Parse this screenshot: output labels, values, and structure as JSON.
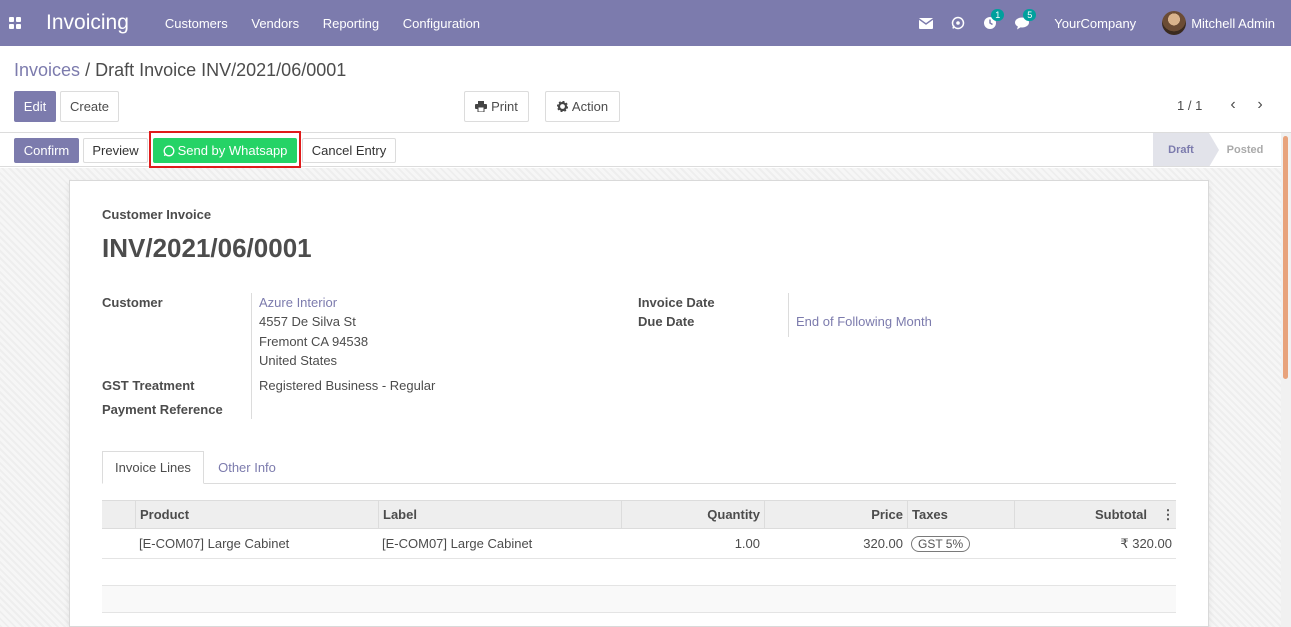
{
  "navbar": {
    "app_title": "Invoicing",
    "menu": [
      "Customers",
      "Vendors",
      "Reporting",
      "Configuration"
    ],
    "activity_count": "1",
    "messages_count": "5",
    "company": "YourCompany",
    "user": "Mitchell Admin"
  },
  "breadcrumb": {
    "parent": "Invoices",
    "separator": "/",
    "current": "Draft Invoice INV/2021/06/0001"
  },
  "control": {
    "edit": "Edit",
    "create": "Create",
    "print": "Print",
    "action": "Action",
    "pager": "1 / 1"
  },
  "statusbar": {
    "confirm": "Confirm",
    "preview": "Preview",
    "whatsapp": "Send by Whatsapp",
    "cancel": "Cancel Entry",
    "stages": [
      "Draft",
      "Posted"
    ],
    "active_stage": "Draft"
  },
  "form": {
    "type_label": "Customer Invoice",
    "name": "INV/2021/06/0001",
    "customer_label": "Customer",
    "customer_name": "Azure Interior",
    "address": [
      "4557 De Silva St",
      "Fremont CA 94538",
      "United States"
    ],
    "gst_label": "GST Treatment",
    "gst_value": "Registered Business - Regular",
    "payment_ref_label": "Payment Reference",
    "invoice_date_label": "Invoice Date",
    "due_date_label": "Due Date",
    "due_date_value": "End of Following Month"
  },
  "tabs": [
    "Invoice Lines",
    "Other Info"
  ],
  "table": {
    "columns": [
      "Product",
      "Label",
      "Quantity",
      "Price",
      "Taxes",
      "Subtotal"
    ],
    "rows": [
      {
        "product": "[E-COM07] Large Cabinet",
        "label": "[E-COM07] Large Cabinet",
        "quantity": "1.00",
        "price": "320.00",
        "taxes": "GST 5%",
        "subtotal": "₹ 320.00"
      }
    ]
  },
  "colors": {
    "brand": "#7c7bad",
    "whatsapp": "#25d366",
    "highlight": "#e01b1b",
    "badge": "#00a09d"
  }
}
